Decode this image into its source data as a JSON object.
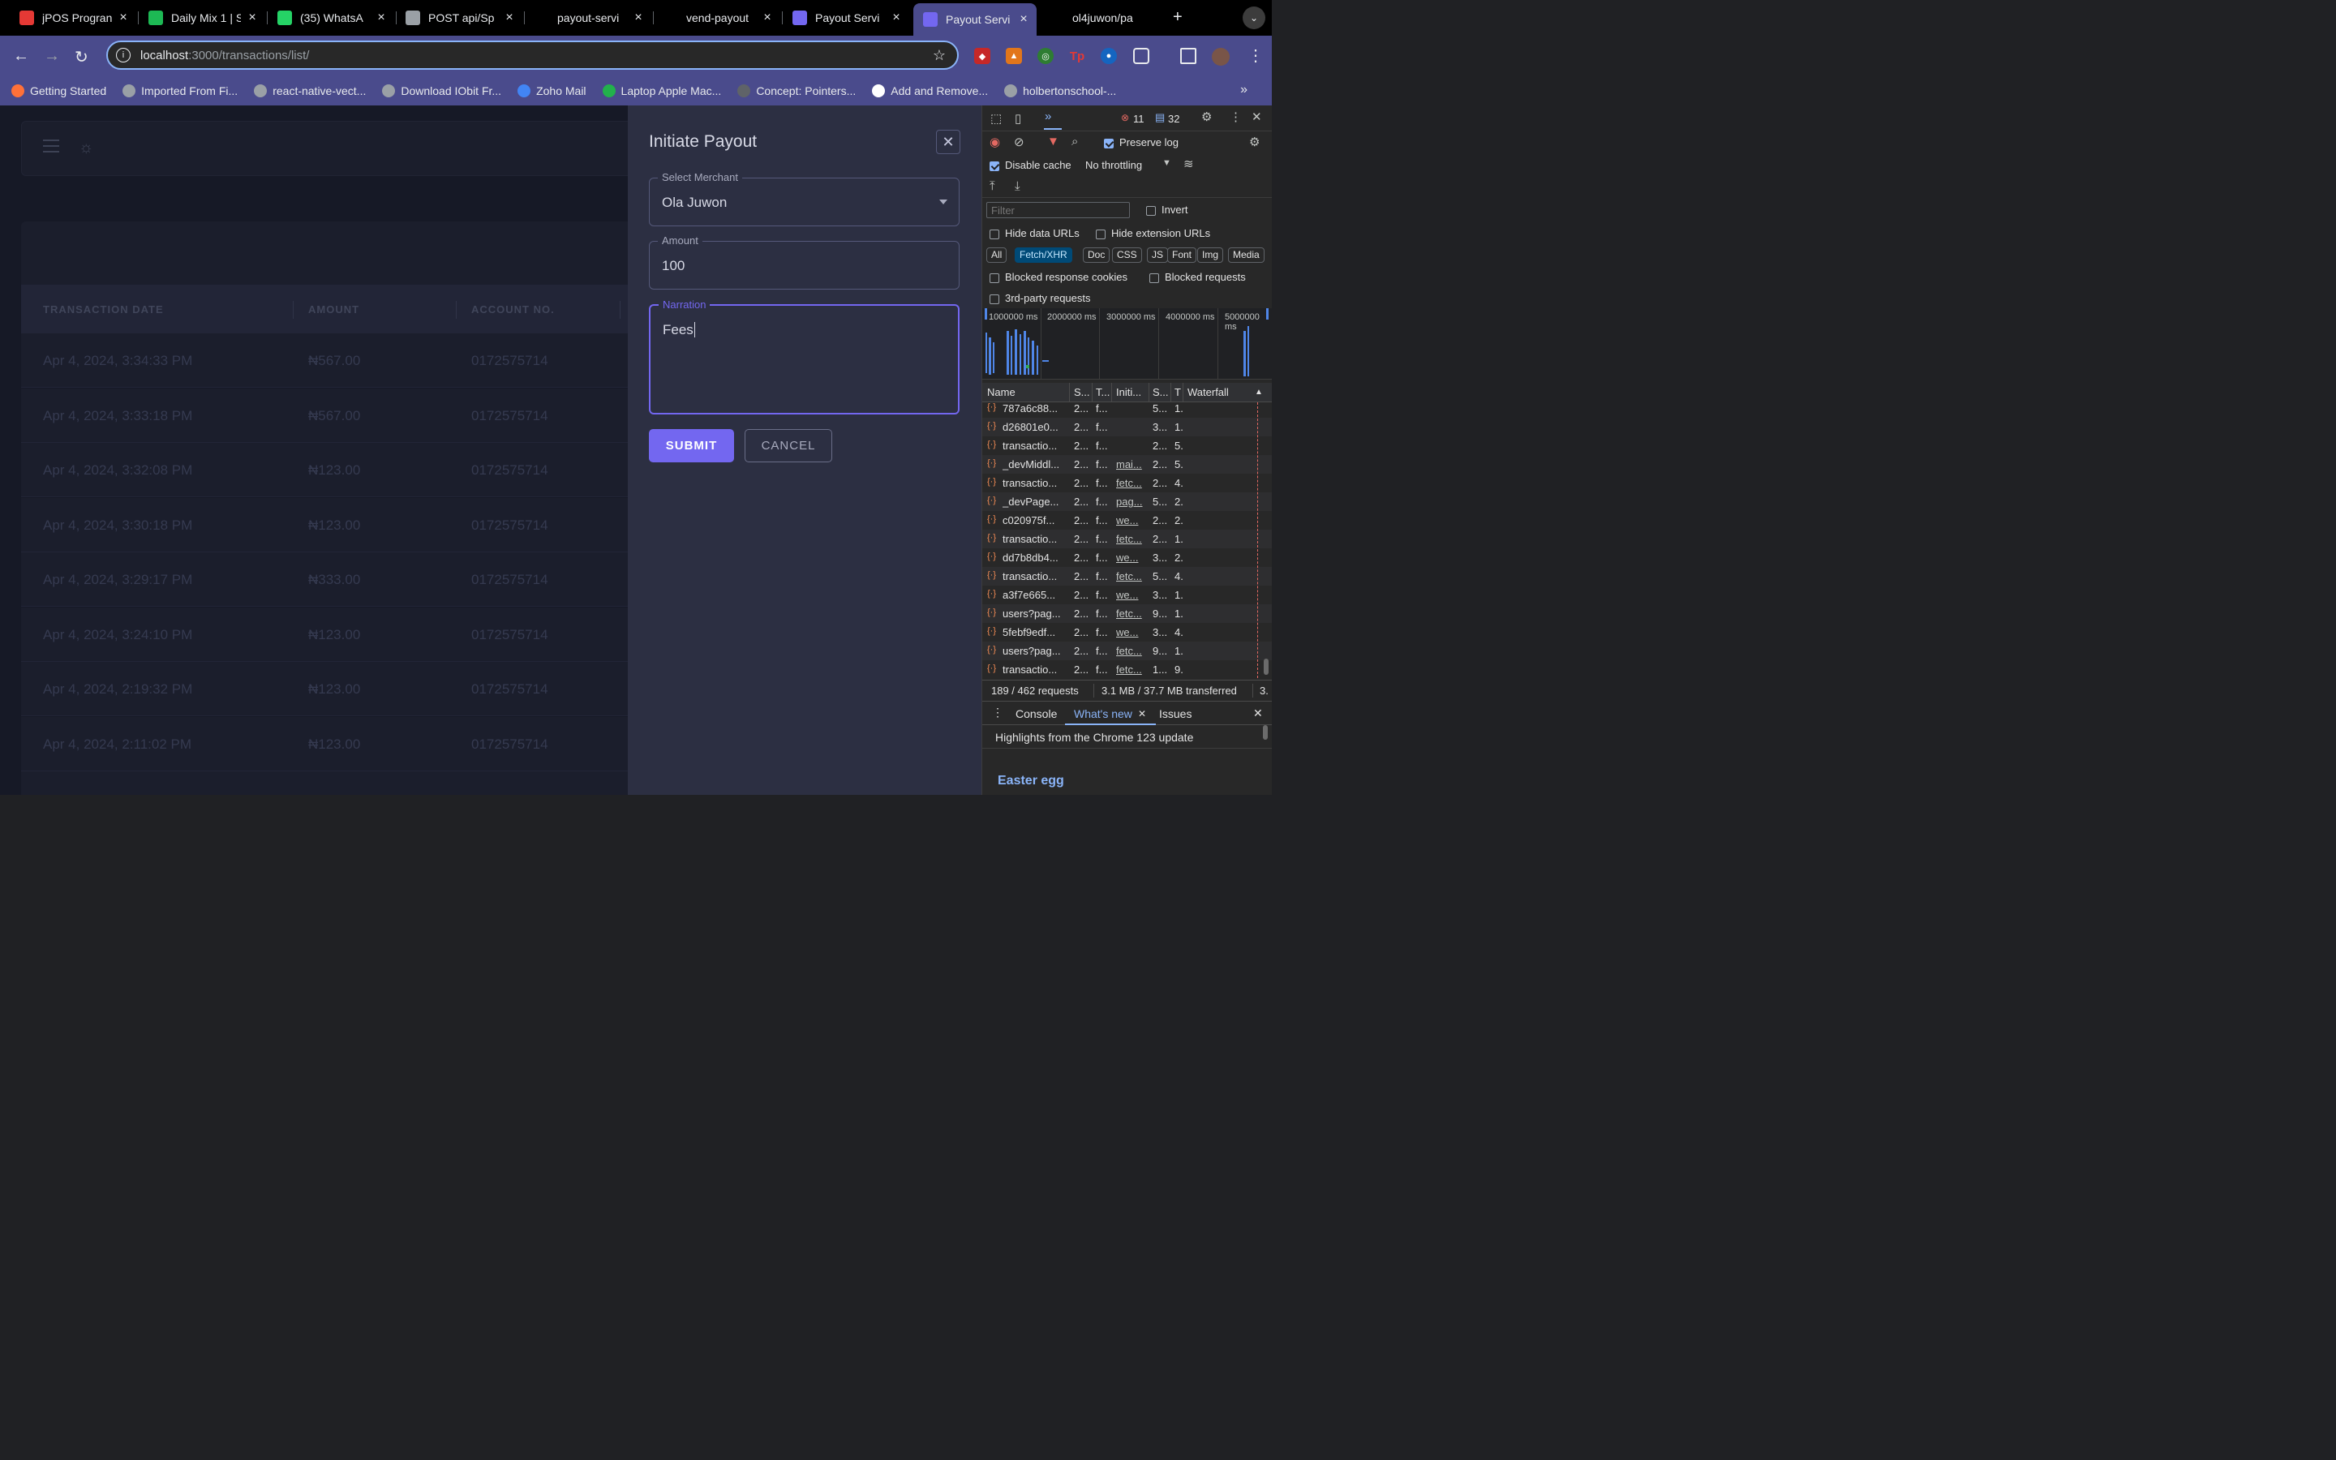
{
  "tabs": [
    {
      "title": "jPOS Progran",
      "icon": "jpos-icon",
      "color": "#e53935"
    },
    {
      "title": "Daily Mix 1 | S",
      "icon": "spotify-icon",
      "color": "#1db954"
    },
    {
      "title": "(35) WhatsA",
      "icon": "whatsapp-icon",
      "color": "#25d366"
    },
    {
      "title": "POST api/Sp",
      "icon": "globe-icon",
      "color": "#9aa0a6"
    },
    {
      "title": "payout-servi",
      "icon": "vercel-icon",
      "color": "#000000"
    },
    {
      "title": "vend-payout",
      "icon": "git-branch-icon",
      "color": "#000000"
    },
    {
      "title": "Payout Servi",
      "icon": "folder-icon",
      "color": "#7367f0"
    },
    {
      "title": "Payout Servi",
      "icon": "folder-icon",
      "color": "#7367f0"
    },
    {
      "title": "ol4juwon/pa",
      "icon": "github-icon",
      "color": "#000000"
    }
  ],
  "omnibox": {
    "host": "localhost",
    "path": ":3000/transactions/list/"
  },
  "bookmarks": [
    {
      "label": "Getting Started",
      "color": "#ff7139"
    },
    {
      "label": "Imported From Fi...",
      "color": "#9aa0a6"
    },
    {
      "label": "react-native-vect...",
      "color": "#9aa0a6"
    },
    {
      "label": "Download IObit Fr...",
      "color": "#9aa0a6"
    },
    {
      "label": "Zoho Mail",
      "color": "#4285f4"
    },
    {
      "label": "Laptop Apple Mac...",
      "color": "#22b14c"
    },
    {
      "label": "Concept: Pointers...",
      "color": "#5f6368"
    },
    {
      "label": "Add and Remove...",
      "color": "#ffffff"
    },
    {
      "label": "holbertonschool-...",
      "color": "#9aa0a6"
    }
  ],
  "table": {
    "headers": [
      "TRANSACTION DATE",
      "AMOUNT",
      "ACCOUNT NO."
    ],
    "rows": [
      {
        "date": "Apr 4, 2024, 3:34:33 PM",
        "amount": "₦567.00",
        "account": "0172575714"
      },
      {
        "date": "Apr 4, 2024, 3:33:18 PM",
        "amount": "₦567.00",
        "account": "0172575714"
      },
      {
        "date": "Apr 4, 2024, 3:32:08 PM",
        "amount": "₦123.00",
        "account": "0172575714"
      },
      {
        "date": "Apr 4, 2024, 3:30:18 PM",
        "amount": "₦123.00",
        "account": "0172575714"
      },
      {
        "date": "Apr 4, 2024, 3:29:17 PM",
        "amount": "₦333.00",
        "account": "0172575714"
      },
      {
        "date": "Apr 4, 2024, 3:24:10 PM",
        "amount": "₦123.00",
        "account": "0172575714"
      },
      {
        "date": "Apr 4, 2024, 2:19:32 PM",
        "amount": "₦123.00",
        "account": "0172575714"
      },
      {
        "date": "Apr 4, 2024, 2:11:02 PM",
        "amount": "₦123.00",
        "account": "0172575714"
      }
    ]
  },
  "drawer": {
    "title": "Initiate Payout",
    "merchant_label": "Select Merchant",
    "merchant_value": "Ola Juwon",
    "amount_label": "Amount",
    "amount_value": "100",
    "narration_label": "Narration",
    "narration_value": "Fees",
    "submit": "SUBMIT",
    "cancel": "CANCEL"
  },
  "devtools": {
    "errors": "11",
    "messages": "32",
    "preserve_log": "Preserve log",
    "disable_cache": "Disable cache",
    "throttling": "No throttling",
    "filter_placeholder": "Filter",
    "invert": "Invert",
    "hide_data_urls": "Hide data URLs",
    "hide_extension_urls": "Hide extension URLs",
    "chips": [
      "All",
      "Fetch/XHR",
      "Doc",
      "CSS",
      "JS",
      "Font",
      "Img",
      "Media"
    ],
    "active_chip": "Fetch/XHR",
    "blocked_cookies": "Blocked response cookies",
    "blocked_requests": "Blocked requests",
    "third_party": "3rd-party requests",
    "timeline_labels": [
      "1000000 ms",
      "2000000 ms",
      "3000000 ms",
      "4000000 ms",
      "5000000 ms"
    ],
    "columns": [
      "Name",
      "S...",
      "T...",
      "Initi...",
      "S...",
      "T",
      "Waterfall"
    ],
    "requests": [
      {
        "name": "787a6c88...",
        "s": "2...",
        "t": "f...",
        "init": "",
        "size": "5...",
        "time": "1..",
        "link": false
      },
      {
        "name": "d26801e0...",
        "s": "2...",
        "t": "f...",
        "init": "",
        "size": "3...",
        "time": "1.",
        "link": false
      },
      {
        "name": "transactio...",
        "s": "2...",
        "t": "f...",
        "init": "",
        "size": "2...",
        "time": "5.",
        "link": false
      },
      {
        "name": "_devMiddl...",
        "s": "2...",
        "t": "f...",
        "init": "mai...",
        "size": "2...",
        "time": "5.",
        "link": true
      },
      {
        "name": "transactio...",
        "s": "2...",
        "t": "f...",
        "init": "fetc...",
        "size": "2...",
        "time": "4.",
        "link": true
      },
      {
        "name": "_devPage...",
        "s": "2...",
        "t": "f...",
        "init": "pag...",
        "size": "5...",
        "time": "2.",
        "link": true
      },
      {
        "name": "c020975f...",
        "s": "2...",
        "t": "f...",
        "init": "we...",
        "size": "2...",
        "time": "2.",
        "link": true
      },
      {
        "name": "transactio...",
        "s": "2...",
        "t": "f...",
        "init": "fetc...",
        "size": "2...",
        "time": "1.",
        "link": true
      },
      {
        "name": "dd7b8db4...",
        "s": "2...",
        "t": "f...",
        "init": "we...",
        "size": "3...",
        "time": "2.",
        "link": true
      },
      {
        "name": "transactio...",
        "s": "2...",
        "t": "f...",
        "init": "fetc...",
        "size": "5...",
        "time": "4.",
        "link": true
      },
      {
        "name": "a3f7e665...",
        "s": "2...",
        "t": "f...",
        "init": "we...",
        "size": "3...",
        "time": "1.",
        "link": true
      },
      {
        "name": "users?pag...",
        "s": "2...",
        "t": "f...",
        "init": "fetc...",
        "size": "9...",
        "time": "1.",
        "link": true
      },
      {
        "name": "5febf9edf...",
        "s": "2...",
        "t": "f...",
        "init": "we...",
        "size": "3...",
        "time": "4.",
        "link": true
      },
      {
        "name": "users?pag...",
        "s": "2...",
        "t": "f...",
        "init": "fetc...",
        "size": "9...",
        "time": "1.",
        "link": true
      },
      {
        "name": "transactio...",
        "s": "2...",
        "t": "f...",
        "init": "fetc...",
        "size": "1...",
        "time": "9.",
        "link": true
      }
    ],
    "status_requests": "189 / 462 requests",
    "status_transferred": "3.1 MB / 37.7 MB transferred",
    "status_more": "3.",
    "drawer_tabs": [
      "Console",
      "What's new",
      "Issues"
    ],
    "highlights": "Highlights from the Chrome 123 update",
    "easter_egg": "Easter egg"
  }
}
